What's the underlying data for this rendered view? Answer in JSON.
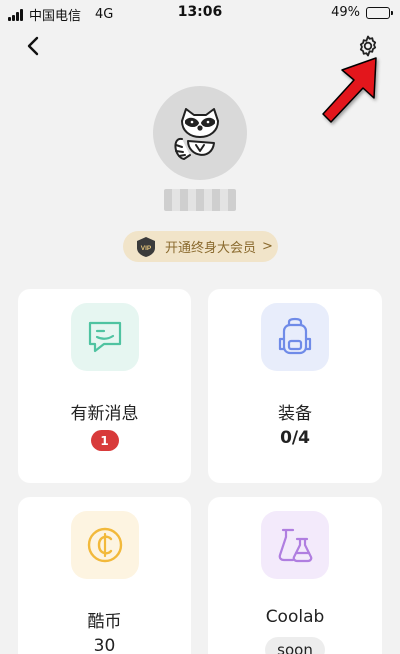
{
  "status_bar": {
    "carrier": "中国电信",
    "network": "4G",
    "time": "13:06",
    "battery_percent": "49%",
    "battery_level": 0.49
  },
  "profile": {
    "username": "▇▇▇▇▇▇",
    "vip_badge": "VIP",
    "vip_text": "开通终身大会员",
    "vip_chevron": ">"
  },
  "cards": [
    {
      "label": "有新消息",
      "badge": "1",
      "icon": "message-icon",
      "color": "#4fc3a1"
    },
    {
      "label": "装备",
      "count": "0/4",
      "icon": "backpack-icon",
      "color": "#6f8be8"
    },
    {
      "label": "酷币",
      "count": "30",
      "icon": "coin-icon",
      "color": "#f2b93b"
    },
    {
      "label": "Coolab",
      "status": "soon",
      "icon": "flask-icon",
      "color": "#b07ee0"
    }
  ],
  "colors": {
    "background": "#f2f2f2",
    "vip_pill": "#f1e4c9",
    "badge_red": "#d83a3a",
    "arrow_red": "#e3141b"
  }
}
